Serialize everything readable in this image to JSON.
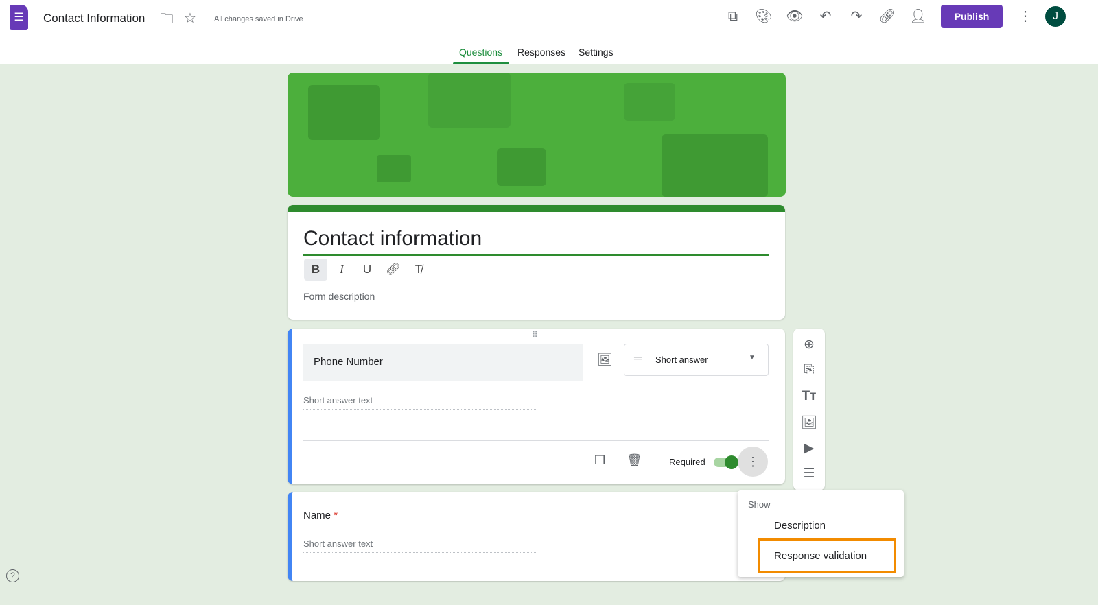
{
  "header": {
    "title": "Contact Information",
    "save_status": "All changes saved in Drive",
    "publish": "Publish",
    "avatar": "J",
    "icons": [
      "add-ons-icon",
      "palette-icon",
      "preview-icon",
      "undo-icon",
      "redo-icon",
      "link-icon",
      "add-collaborator-icon",
      "more-icon"
    ]
  },
  "tabs": [
    "Questions",
    "Responses",
    "Settings"
  ],
  "accent": "#673ab7",
  "theme": "#2e8b2e",
  "form": {
    "title": "Contact information",
    "description_placeholder": "Form description"
  },
  "question1": {
    "title": "Phone Number",
    "type": "Short answer",
    "answer_placeholder": "Short answer text",
    "required_label": "Required",
    "required": true
  },
  "question2": {
    "title": "Name",
    "required_mark": "*",
    "answer_placeholder": "Short answer text"
  },
  "menu": {
    "header": "Show",
    "items": [
      "Description",
      "Response validation"
    ]
  },
  "help": "?"
}
